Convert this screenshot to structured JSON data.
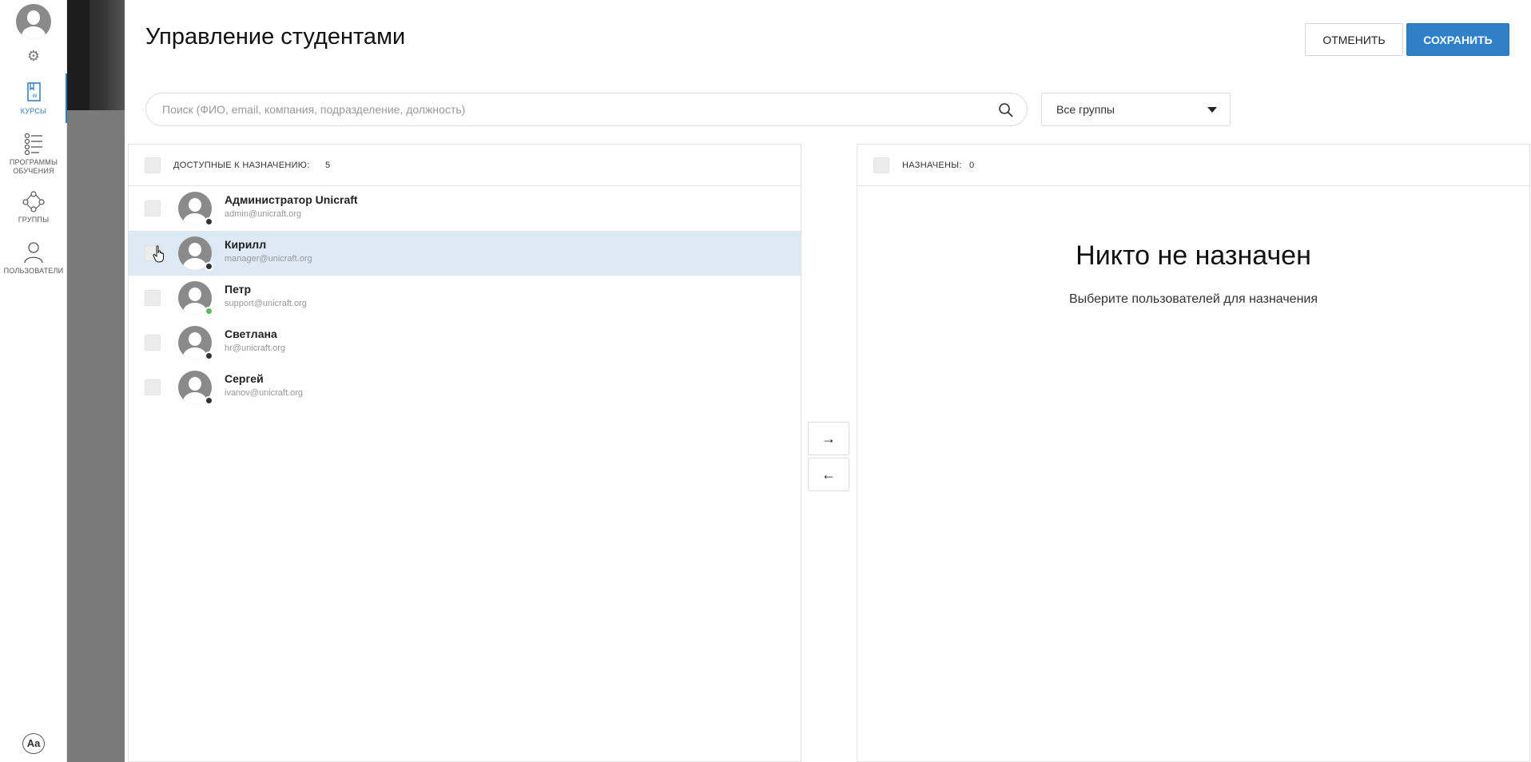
{
  "sidebar": {
    "items": [
      {
        "label": "Курсы",
        "icon": "book-icon",
        "active": true
      },
      {
        "label": "Программы обучения",
        "icon": "checklist-icon",
        "active": false
      },
      {
        "label": "Группы",
        "icon": "group-icon",
        "active": false
      },
      {
        "label": "Пользователи",
        "icon": "user-icon",
        "active": false
      }
    ],
    "font_icon_label": "Aa"
  },
  "header": {
    "title": "Управление студентами",
    "cancel_label": "ОТМЕНИТЬ",
    "save_label": "СОХРАНИТЬ"
  },
  "search": {
    "placeholder": "Поиск (ФИО, email, компания, подразделение, должность)",
    "value": ""
  },
  "group_filter": {
    "selected": "Все группы"
  },
  "available": {
    "label": "Доступные к назначению:",
    "count": "5",
    "users": [
      {
        "name": "Администратор Unicraft",
        "email": "admin@unicraft.org",
        "status": "offline",
        "selected": false
      },
      {
        "name": "Кирилл",
        "email": "manager@unicraft.org",
        "status": "offline",
        "selected": true
      },
      {
        "name": "Петр",
        "email": "support@unicraft.org",
        "status": "online",
        "selected": false
      },
      {
        "name": "Светлана",
        "email": "hr@unicraft.org",
        "status": "offline",
        "selected": false
      },
      {
        "name": "Сергей",
        "email": "ivanov@unicraft.org",
        "status": "offline",
        "selected": false
      }
    ]
  },
  "assigned": {
    "label": "Назначены:",
    "count": "0",
    "empty_title": "Никто не назначен",
    "empty_subtitle": "Выберите пользователей для назначения"
  },
  "transfer": {
    "right_label": "→",
    "left_label": "←"
  },
  "colors": {
    "accent": "#2f80c6",
    "selected_row": "#dde9f5",
    "online": "#5cb85c",
    "offline": "#333333"
  }
}
